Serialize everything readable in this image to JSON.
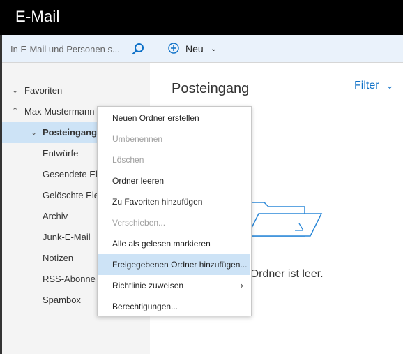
{
  "app": {
    "title": "E-Mail"
  },
  "search": {
    "placeholder": "In E-Mail und Personen s..."
  },
  "folders": {
    "favorites": "Favoriten",
    "account": "Max Mustermann",
    "items": [
      {
        "label": "Posteingang",
        "selected": true
      },
      {
        "label": "Entwürfe"
      },
      {
        "label": "Gesendete Ele"
      },
      {
        "label": "Gelöschte Ele"
      },
      {
        "label": "Archiv"
      },
      {
        "label": "Junk-E-Mail"
      },
      {
        "label": "Notizen"
      },
      {
        "label": "RSS-Abonne"
      },
      {
        "label": "Spambox"
      }
    ]
  },
  "toolbar": {
    "new_label": "Neu"
  },
  "main": {
    "title": "Posteingang",
    "filter_label": "Filter",
    "empty_text": "er Ordner ist leer."
  },
  "context_menu": {
    "items": [
      {
        "label": "Neuen Ordner erstellen",
        "disabled": false
      },
      {
        "label": "Umbenennen",
        "disabled": true
      },
      {
        "label": "Löschen",
        "disabled": true
      },
      {
        "label": "Ordner leeren",
        "disabled": false
      },
      {
        "label": "Zu Favoriten hinzufügen",
        "disabled": false
      },
      {
        "label": "Verschieben...",
        "disabled": true
      },
      {
        "label": "Alle als gelesen markieren",
        "disabled": false
      },
      {
        "label": "Freigegebenen Ordner hinzufügen...",
        "disabled": false,
        "highlighted": true
      },
      {
        "label": "Richtlinie zuweisen",
        "disabled": false,
        "submenu": true
      },
      {
        "label": "Berechtigungen...",
        "disabled": false
      }
    ]
  },
  "colors": {
    "accent": "#0b6fc7",
    "selection": "#cde3f6",
    "titlebar": "#000000"
  },
  "icons": {
    "search": "search-icon",
    "new": "plus-circle-icon",
    "folder": "folder-icon"
  }
}
